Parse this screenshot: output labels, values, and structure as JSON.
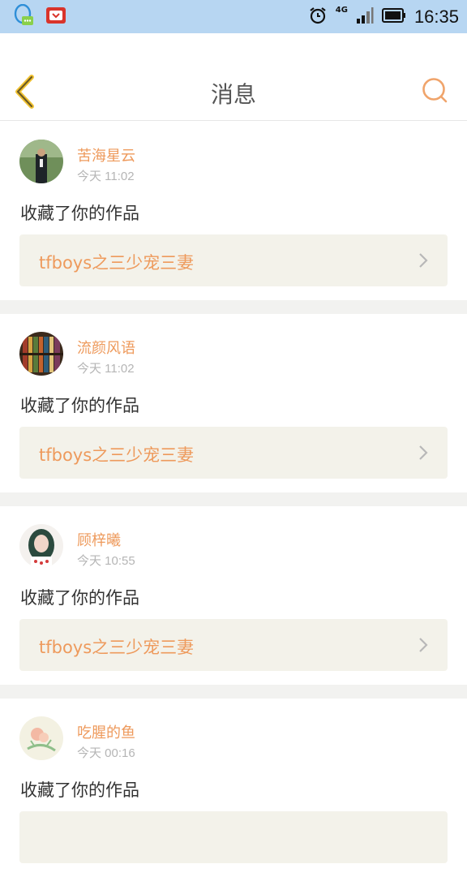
{
  "status_bar": {
    "network": "4G",
    "time": "16:35",
    "icons": [
      "qq-icon",
      "notification-app-icon",
      "alarm-icon",
      "signal-icon",
      "battery-icon"
    ]
  },
  "header": {
    "title": "消息",
    "back_icon": "chevron-left-icon",
    "search_icon": "search-icon"
  },
  "colors": {
    "accent": "#ee9a5c",
    "status_bar": "#b7d6f2",
    "card_link_bg": "#f3f2ea",
    "separator": "#f2f2f0"
  },
  "messages": [
    {
      "user": "苦海星云",
      "time": "今天 11:02",
      "action": "收藏了你的作品",
      "work": "tfboys之三少宠三妻"
    },
    {
      "user": "流颜风语",
      "time": "今天 11:02",
      "action": "收藏了你的作品",
      "work": "tfboys之三少宠三妻"
    },
    {
      "user": "顾梓曦",
      "time": "今天 10:55",
      "action": "收藏了你的作品",
      "work": "tfboys之三少宠三妻"
    },
    {
      "user": "吃腥的鱼",
      "time": "今天 00:16",
      "action": "收藏了你的作品",
      "work": ""
    }
  ]
}
